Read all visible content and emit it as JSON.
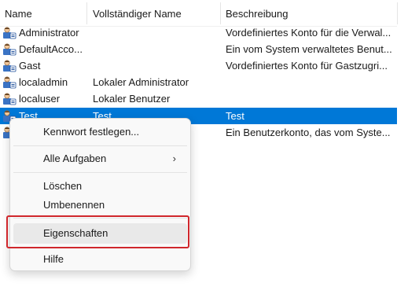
{
  "columns": {
    "name": "Name",
    "fullname": "Vollständiger Name",
    "description": "Beschreibung"
  },
  "rows": [
    {
      "name": "Administrator",
      "fullname": "",
      "description": "Vordefiniertes Konto für die Verwal..."
    },
    {
      "name": "DefaultAcco...",
      "fullname": "",
      "description": "Ein vom System verwaltetes Benut..."
    },
    {
      "name": "Gast",
      "fullname": "",
      "description": "Vordefiniertes Konto für Gastzugri..."
    },
    {
      "name": "localadmin",
      "fullname": "Lokaler Administrator",
      "description": ""
    },
    {
      "name": "localuser",
      "fullname": "Lokaler Benutzer",
      "description": ""
    },
    {
      "name": "Test",
      "fullname": "Test",
      "description": "Test"
    },
    {
      "name": "",
      "fullname": "",
      "description": "Ein Benutzerkonto, das vom Syste..."
    }
  ],
  "context_menu": {
    "set_password": "Kennwort festlegen...",
    "all_tasks": "Alle Aufgaben",
    "all_tasks_arrow": "›",
    "delete": "Löschen",
    "rename": "Umbenennen",
    "properties": "Eigenschaften",
    "help": "Hilfe"
  },
  "colors": {
    "selection": "#0078d7",
    "highlight_border": "#d0272c"
  },
  "icons": {
    "user_row": "user-account-icon",
    "submenu": "chevron-right-icon"
  }
}
